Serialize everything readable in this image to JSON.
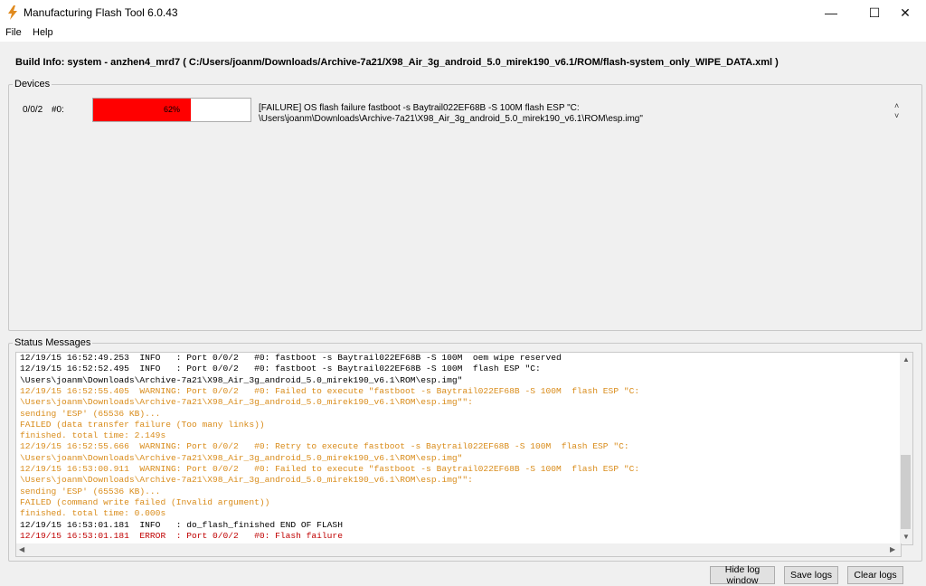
{
  "window": {
    "title": "Manufacturing Flash Tool 6.0.43",
    "minimize_glyph": "—",
    "maximize_glyph": "☐",
    "close_glyph": "✕"
  },
  "menu": {
    "items": [
      "File",
      "Help"
    ]
  },
  "build_info": "Build Info: system - anzhen4_mrd7 ( C:/Users/joanm/Downloads/Archive-7a21/X98_Air_3g_android_5.0_mirek190_v6.1/ROM/flash-system_only_WIPE_DATA.xml )",
  "devices": {
    "group_label": "Devices",
    "port": "0/0/2",
    "device": "#0:",
    "progress_percent": 62,
    "progress_text": "62%",
    "progress_color": "#ff0000",
    "status_line1": "[FAILURE] OS flash failure fastboot -s Baytrail022EF68B -S 100M  flash ESP \"C:",
    "status_line2": "\\Users\\joanm\\Downloads\\Archive-7a21\\X98_Air_3g_android_5.0_mirek190_v6.1\\ROM\\esp.img\"",
    "scroll_up": "˄",
    "scroll_down": "˅"
  },
  "status": {
    "group_label": "Status Messages",
    "lines": [
      {
        "text": "12/19/15 16:52:49.253  INFO   : Port 0/0/2   #0: fastboot -s Baytrail022EF68B -S 100M  oem wipe reserved",
        "level": "info"
      },
      {
        "text": "12/19/15 16:52:52.495  INFO   : Port 0/0/2   #0: fastboot -s Baytrail022EF68B -S 100M  flash ESP \"C:",
        "level": "info"
      },
      {
        "text": "\\Users\\joanm\\Downloads\\Archive-7a21\\X98_Air_3g_android_5.0_mirek190_v6.1\\ROM\\esp.img\"",
        "level": "info"
      },
      {
        "text": "12/19/15 16:52:55.405  WARNING: Port 0/0/2   #0: Failed to execute \"fastboot -s Baytrail022EF68B -S 100M  flash ESP \"C:",
        "level": "warn"
      },
      {
        "text": "\\Users\\joanm\\Downloads\\Archive-7a21\\X98_Air_3g_android_5.0_mirek190_v6.1\\ROM\\esp.img\"\":",
        "level": "warn"
      },
      {
        "text": "sending 'ESP' (65536 KB)...",
        "level": "warn"
      },
      {
        "text": "FAILED (data transfer failure (Too many links))",
        "level": "warn"
      },
      {
        "text": "finished. total time: 2.149s",
        "level": "warn"
      },
      {
        "text": "12/19/15 16:52:55.666  WARNING: Port 0/0/2   #0: Retry to execute fastboot -s Baytrail022EF68B -S 100M  flash ESP \"C:",
        "level": "warn"
      },
      {
        "text": "\\Users\\joanm\\Downloads\\Archive-7a21\\X98_Air_3g_android_5.0_mirek190_v6.1\\ROM\\esp.img\"",
        "level": "warn"
      },
      {
        "text": "12/19/15 16:53:00.911  WARNING: Port 0/0/2   #0: Failed to execute \"fastboot -s Baytrail022EF68B -S 100M  flash ESP \"C:",
        "level": "warn"
      },
      {
        "text": "\\Users\\joanm\\Downloads\\Archive-7a21\\X98_Air_3g_android_5.0_mirek190_v6.1\\ROM\\esp.img\"\":",
        "level": "warn"
      },
      {
        "text": "sending 'ESP' (65536 KB)...",
        "level": "warn"
      },
      {
        "text": "FAILED (command write failed (Invalid argument))",
        "level": "warn"
      },
      {
        "text": "finished. total time: 0.000s",
        "level": "warn"
      },
      {
        "text": "12/19/15 16:53:01.181  INFO   : do_flash_finished END OF FLASH",
        "level": "info"
      },
      {
        "text": "12/19/15 16:53:01.181  ERROR  : Port 0/0/2   #0: Flash failure",
        "level": "error"
      }
    ],
    "level_colors": {
      "info": "#000000",
      "warn": "#d98c1b",
      "error": "#c00000"
    },
    "arrow_up": "▲",
    "arrow_down": "▼",
    "arrow_left": "◀",
    "arrow_right": "▶"
  },
  "buttons": {
    "hide_log": "Hide log window",
    "save_logs": "Save logs",
    "clear_logs": "Clear logs"
  }
}
